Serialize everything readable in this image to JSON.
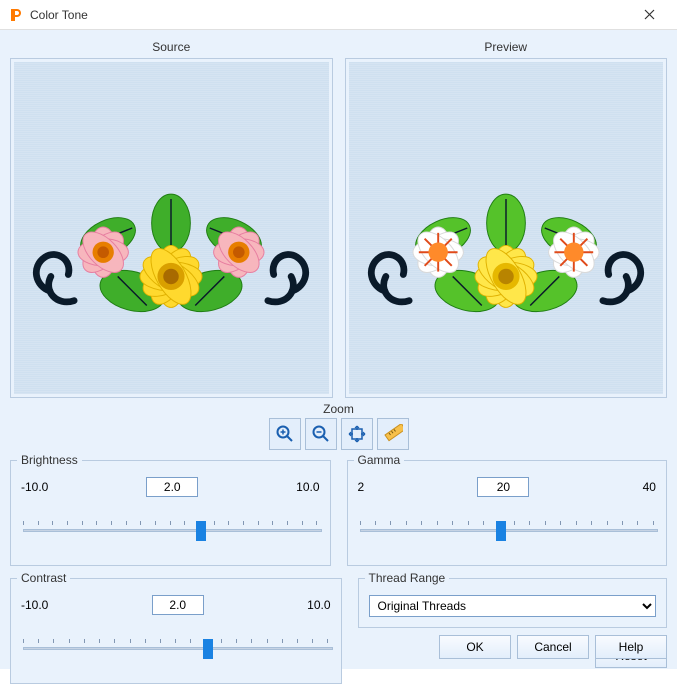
{
  "window": {
    "title": "Color Tone"
  },
  "panels": {
    "source": "Source",
    "preview": "Preview"
  },
  "zoom": {
    "label": "Zoom"
  },
  "brightness": {
    "label": "Brightness",
    "min_label": "-10.0",
    "max_label": "10.0",
    "value": "2.0",
    "min": -10,
    "max": 10,
    "val": 2.0
  },
  "gamma": {
    "label": "Gamma",
    "min_label": "2",
    "max_label": "40",
    "value": "20",
    "min": 2,
    "max": 40,
    "val": 20
  },
  "contrast": {
    "label": "Contrast",
    "min_label": "-10.0",
    "max_label": "10.0",
    "value": "2.0",
    "min": -10,
    "max": 10,
    "val": 2.0
  },
  "thread_range": {
    "label": "Thread Range",
    "selected": "Original Threads"
  },
  "buttons": {
    "reset": "Reset",
    "ok": "OK",
    "cancel": "Cancel",
    "help": "Help"
  }
}
